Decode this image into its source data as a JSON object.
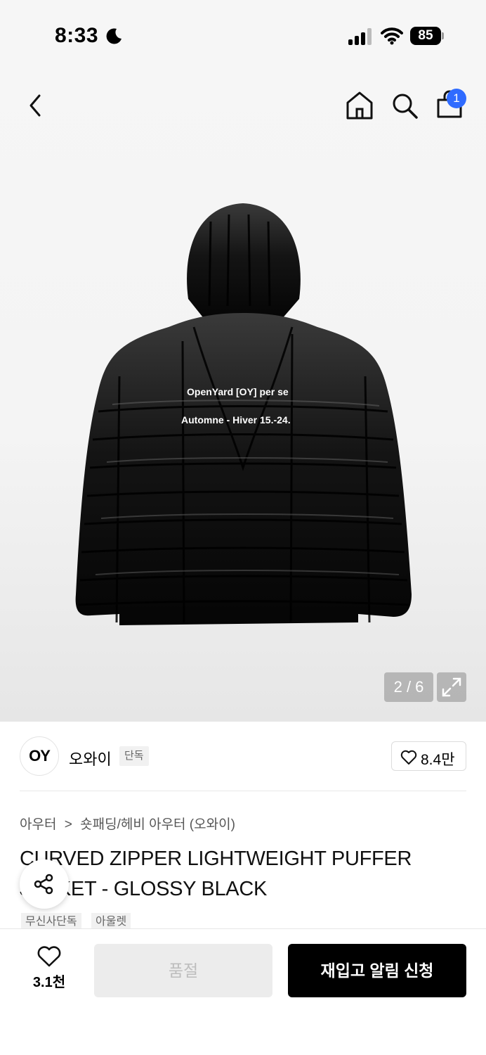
{
  "status_bar": {
    "time": "8:33",
    "battery": "85"
  },
  "header": {
    "cart_badge": "1"
  },
  "gallery": {
    "page_indicator": "2 / 6",
    "print_line1": "OpenYard [OY] per se",
    "print_line2": "Automne - Hiver 15.-24."
  },
  "brand": {
    "logo_text": "OY",
    "name": "오와이",
    "tag": "단독",
    "likes": "8.4만"
  },
  "breadcrumb": {
    "category": "아우터",
    "separator": ">",
    "subcategory": "숏패딩/헤비 아우터 (오와이)"
  },
  "product": {
    "title": "CURVED ZIPPER LIGHTWEIGHT PUFFER JACKET - GLOSSY BLACK",
    "chips": [
      "무신사단독",
      "아울렛"
    ]
  },
  "bottom_bar": {
    "wish_count": "3.1천",
    "soldout_label": "품절",
    "restock_label": "재입고 알림 신청"
  },
  "colors": {
    "accent_blue": "#2f6bff",
    "primary_black": "#000000",
    "disabled_gray": "#ececec"
  }
}
